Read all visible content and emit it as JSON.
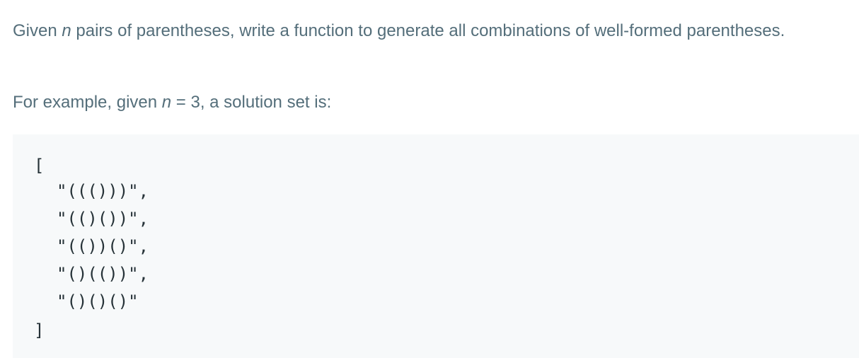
{
  "intro": {
    "prefix": "Given ",
    "var": "n",
    "suffix": " pairs of parentheses, write a function to generate all combinations of well-formed parentheses."
  },
  "example": {
    "prefix": "For example, given ",
    "var": "n",
    "suffix": " = 3, a solution set is:"
  },
  "code": {
    "open": "[",
    "items": [
      "\"((()))\",",
      "\"(()())\",",
      "\"(())()\",",
      "\"()(())\",",
      "\"()()()\""
    ],
    "close": "]"
  }
}
